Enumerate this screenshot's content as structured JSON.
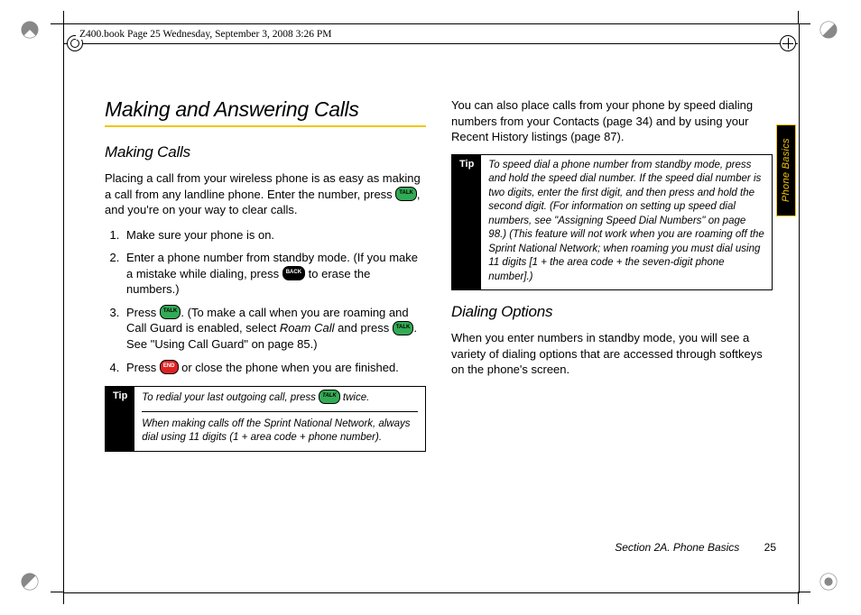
{
  "header": {
    "running": "Z400.book  Page 25  Wednesday, September 3, 2008  3:26 PM"
  },
  "side_tab": "Phone Basics",
  "left": {
    "title": "Making and Answering Calls",
    "h2": "Making Calls",
    "intro_a": "Placing a call from your wireless phone is as easy as making a call from any landline phone. Enter the number, press ",
    "intro_key": "TALK",
    "intro_b": ", and you're on your way to clear calls.",
    "steps": [
      {
        "text": "Make sure your phone is on."
      },
      {
        "pre": "Enter a phone number from standby mode. (If you make a mistake while dialing, press ",
        "key": "BACK",
        "post": " to erase the numbers.)"
      },
      {
        "pre": "Press ",
        "key": "TALK",
        "mid": ". (To make a call when you are roaming and Call Guard is enabled, select ",
        "roam": "Roam Call",
        "mid2": " and press ",
        "key2": "TALK",
        "post": ". See \"Using Call Guard\" on page 85.)"
      },
      {
        "pre": "Press ",
        "key": "END",
        "post": " or close the phone when you are finished."
      }
    ],
    "tip": {
      "label": "Tip",
      "row1_a": "To redial your last outgoing call, press ",
      "row1_key": "TALK",
      "row1_b": " twice.",
      "row2": "When making calls off the Sprint National Network, always dial using 11 digits (1 + area code + phone number)."
    }
  },
  "right": {
    "para1": "You can also place calls from your phone by speed dialing numbers from your Contacts (page 34) and by using your Recent History listings (page 87).",
    "tip": {
      "label": "Tip",
      "body": "To speed dial a phone number from standby mode, press and hold the speed dial number. If the speed dial number is two digits, enter the first digit, and then press and hold the second digit. (For information on setting up speed dial numbers, see \"Assigning Speed Dial Numbers\" on page 98.) (This feature will not work when you are roaming off the Sprint National Network; when roaming you must dial using 11 digits [1 + the area code + the seven-digit phone number].)"
    },
    "h2": "Dialing Options",
    "para2": "When you enter numbers in standby mode, you will see a variety of dialing options that are accessed through softkeys on the phone's screen."
  },
  "footer": {
    "section": "Section 2A. Phone Basics",
    "page": "25"
  }
}
